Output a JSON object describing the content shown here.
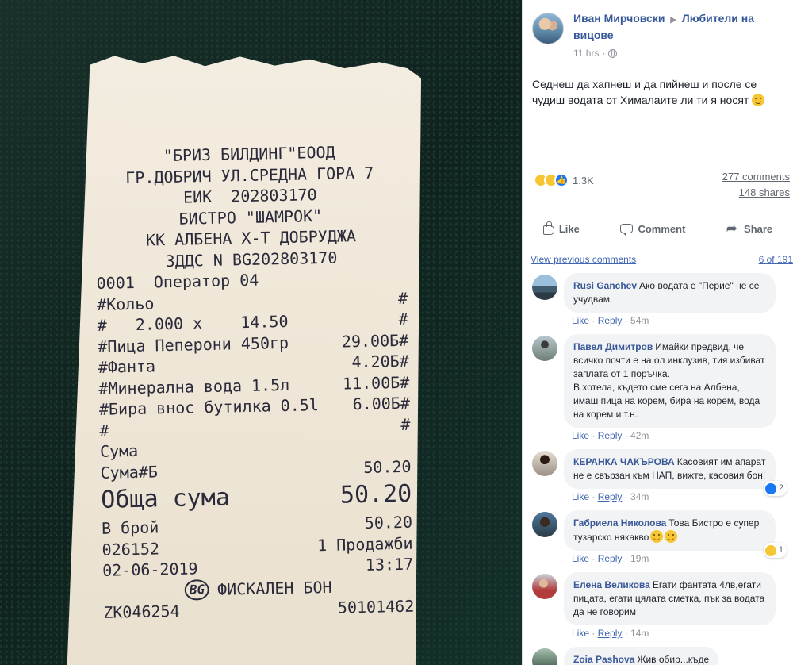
{
  "photo": {
    "receipt_lines": [
      {
        "l": "\"БРИЗ БИЛДИНГ\"ЕООД",
        "r": "",
        "center": true
      },
      {
        "l": "ГР.ДОБРИЧ УЛ.СРЕДНА ГОРА 7",
        "r": "",
        "center": true
      },
      {
        "l": "ЕИК  202803170",
        "r": "",
        "center": true
      },
      {
        "l": "БИСТРО \"ШАМРОК\"",
        "r": "",
        "center": true
      },
      {
        "l": "КК АЛБЕНА Х-Т ДОБРУДЖА",
        "r": "",
        "center": true
      },
      {
        "l": "ЗДДС N BG202803170",
        "r": "",
        "center": true
      },
      {
        "l": "0001  Оператор 04",
        "r": ""
      },
      {
        "l": "#Кольо",
        "r": "#"
      },
      {
        "l": "#   2.000 x    14.50",
        "r": "#"
      },
      {
        "l": "#Пица Пеперони 450гр",
        "r": "29.00Б#"
      },
      {
        "l": "#Фанта",
        "r": "4.20Б#"
      },
      {
        "l": "#Минерална вода 1.5л",
        "r": "11.00Б#"
      },
      {
        "l": "#Бира внос бутилка 0.5l",
        "r": "6.00Б#"
      },
      {
        "l": "#",
        "r": "#"
      },
      {
        "l": "Сума",
        "r": ""
      },
      {
        "l": "Сума#Б",
        "r": "50.20"
      },
      {
        "l": "Обща сума",
        "r": "50.20",
        "big": true
      },
      {
        "l": "В брой",
        "r": "50.20"
      },
      {
        "l": "026152",
        "r": "1 Продажби"
      },
      {
        "l": "02-06-2019",
        "r": "13:17"
      },
      {
        "l": "ФИСКАЛЕН БОН",
        "r": "",
        "center": true,
        "logo": "BG"
      },
      {
        "l": "ZK046254",
        "r": "50101462"
      }
    ]
  },
  "post": {
    "author": "Иван Мирчовски",
    "group": "Любители на вицове",
    "time": "11 hrs",
    "text": "Седнеш да хапнеш и да пийнеш и после се чудиш водата от Хималаите ли ти я носят",
    "reaction_count": "1.3K",
    "comments_count": "277 comments",
    "shares_count": "148 shares",
    "actions": {
      "like": "Like",
      "comment": "Comment",
      "share": "Share"
    }
  },
  "comments_header": {
    "view_previous": "View previous comments",
    "count": "6 of 191"
  },
  "comments": [
    {
      "name": "Rusi Ganchev",
      "text": "Ако водата е \"Перие\" не се учудвам.",
      "like": "Like",
      "reply": "Reply",
      "time": "54m",
      "avatar": "av1"
    },
    {
      "name": "Павел Димитров",
      "text": "Имайки предвид, че всичко почти е на ол инклузив, тия избиват заплата от 1 поръчка.\nВ хотела, където сме сега на Албена, имаш пица на корем, бира на корем, вода на корем и т.н.",
      "like": "Like",
      "reply": "Reply",
      "time": "42m",
      "avatar": "av2"
    },
    {
      "name": "КЕРАНКА ЧАКЪРОВА",
      "text": "Касовият им апарат не е свързан към НАП, вижте, касовия бон!",
      "like": "Like",
      "reply": "Reply",
      "time": "34m",
      "avatar": "av3",
      "react": "2",
      "react_type": "like"
    },
    {
      "name": "Габриела Николова",
      "text": "Това Бистро е супер тузарско някакво",
      "like": "Like",
      "reply": "Reply",
      "time": "19m",
      "avatar": "av4",
      "react": "1",
      "react_type": "haha",
      "emoji_after": true
    },
    {
      "name": "Елена Великова",
      "text": "Егати фантата 4лв,егати пицата, егати цялата сметка, пък за водата да не говорим",
      "like": "Like",
      "reply": "Reply",
      "time": "14m",
      "avatar": "av5"
    },
    {
      "name": "Zoia Pashova",
      "text": "Жив обир...къде",
      "like": "",
      "reply": "",
      "time": "",
      "avatar": "av6"
    }
  ]
}
